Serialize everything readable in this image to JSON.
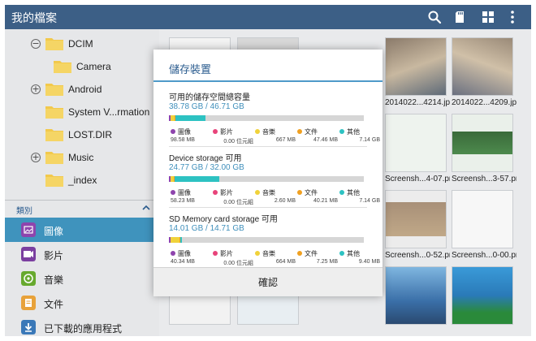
{
  "app": {
    "title": "我的檔案"
  },
  "toolbar": {
    "search_icon": "search-icon",
    "sd_icon": "sd-card-icon",
    "grid_icon": "grid-view-icon",
    "more_icon": "overflow-menu-icon"
  },
  "sidebar": {
    "tree": [
      {
        "label": "DCIM",
        "expander": "−"
      },
      {
        "label": "Camera",
        "expander": ""
      },
      {
        "label": "Android",
        "expander": "+"
      },
      {
        "label": "System V...rmation",
        "expander": ""
      },
      {
        "label": "LOST.DIR",
        "expander": ""
      },
      {
        "label": "Music",
        "expander": "+"
      },
      {
        "label": "_index",
        "expander": ""
      }
    ],
    "category_header": "類別",
    "categories": [
      {
        "label": "圖像",
        "icon": "image-icon",
        "color": "#8e44ad"
      },
      {
        "label": "影片",
        "icon": "video-icon",
        "color": "#7b3fa0"
      },
      {
        "label": "音樂",
        "icon": "music-icon",
        "color": "#67a92e"
      },
      {
        "label": "文件",
        "icon": "document-icon",
        "color": "#e8a23a"
      },
      {
        "label": "已下載的應用程式",
        "icon": "download-icon",
        "color": "#3a78b8"
      }
    ]
  },
  "grid": {
    "captions": [
      "2014022...4214.jpg",
      "2014022...4209.jpg",
      "Screensh...4-07.png",
      "Screensh...3-57.png",
      "Screensh...0-52.png",
      "Screensh...0-00.png"
    ]
  },
  "dialog": {
    "title": "儲存裝置",
    "ok_label": "確認",
    "legend_labels": [
      "圖像",
      "影片",
      "音樂",
      "文件",
      "其他"
    ],
    "legend_colors": [
      "#8e44ad",
      "#e8437a",
      "#f0d23a",
      "#f0a020",
      "#2dc2c2"
    ],
    "sections": [
      {
        "title": "可用的儲存空間總容量",
        "size": "38.78 GB / 46.71 GB",
        "values": [
          "98.58 MB",
          "0.00 位元組",
          "667 MB",
          "47.46 MB",
          "7.14 GB"
        ]
      },
      {
        "title": "Device storage 可用",
        "size": "24.77 GB / 32.00 GB",
        "values": [
          "58.23 MB",
          "0.00 位元組",
          "2.60 MB",
          "40.21 MB",
          "7.14 GB"
        ]
      },
      {
        "title": "SD Memory card storage 可用",
        "size": "14.01 GB / 14.71 GB",
        "values": [
          "40.34 MB",
          "0.00 位元組",
          "664 MB",
          "7.25 MB",
          "9.40 MB"
        ]
      }
    ]
  },
  "colors": {
    "topbar": "#3c5f86",
    "accent": "#3f8fbb",
    "selected": "#3f93bd"
  }
}
